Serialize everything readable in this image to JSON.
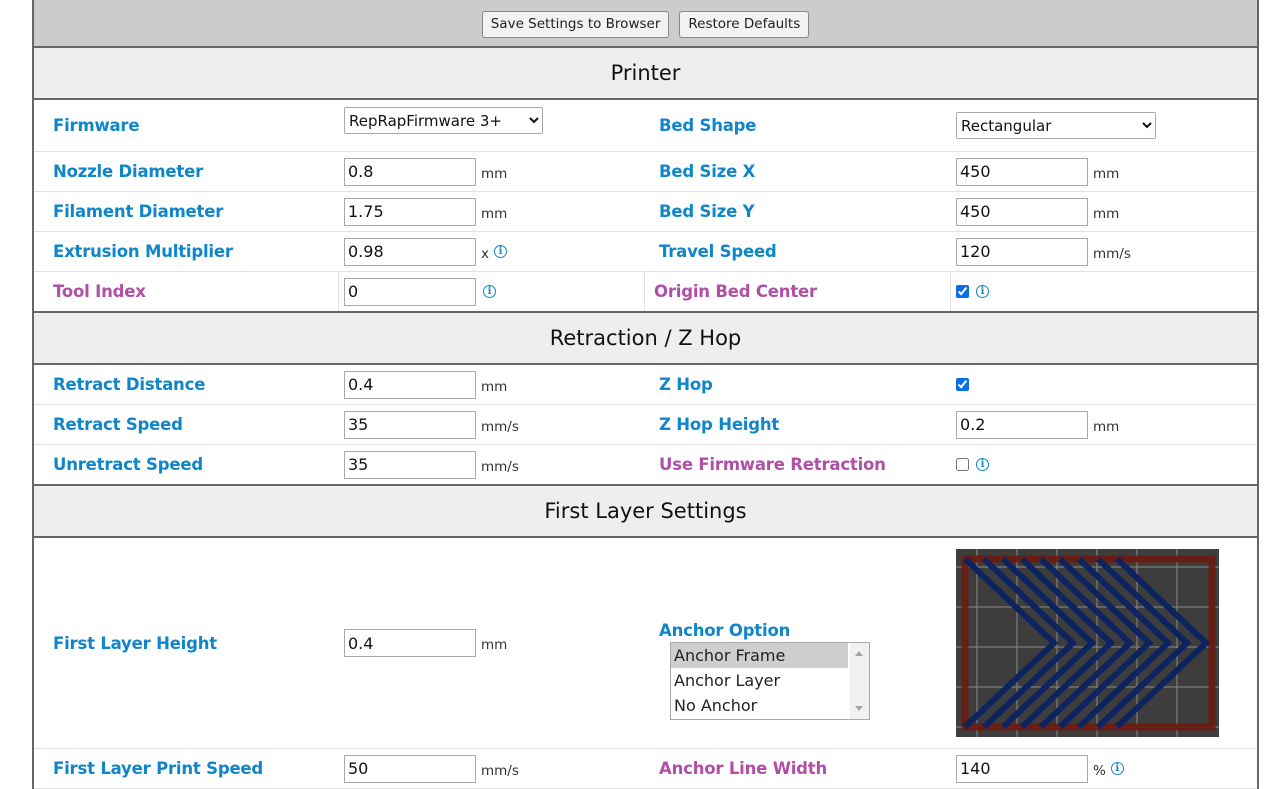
{
  "toolbar": {
    "save_label": "Save Settings to Browser",
    "restore_label": "Restore Defaults"
  },
  "sections": {
    "printer": {
      "title": "Printer",
      "firmware": {
        "label": "Firmware",
        "value": "RepRapFirmware 3+"
      },
      "bed_shape": {
        "label": "Bed Shape",
        "value": "Rectangular"
      },
      "nozzle_diameter": {
        "label": "Nozzle Diameter",
        "value": "0.8",
        "unit": "mm"
      },
      "bed_size_x": {
        "label": "Bed Size X",
        "value": "450",
        "unit": "mm"
      },
      "filament_diameter": {
        "label": "Filament Diameter",
        "value": "1.75",
        "unit": "mm"
      },
      "bed_size_y": {
        "label": "Bed Size Y",
        "value": "450",
        "unit": "mm"
      },
      "extrusion_multiplier": {
        "label": "Extrusion Multiplier",
        "value": "0.98",
        "unit": "x"
      },
      "travel_speed": {
        "label": "Travel Speed",
        "value": "120",
        "unit": "mm/s"
      },
      "tool_index": {
        "label": "Tool Index",
        "value": "0"
      },
      "origin_bed_center": {
        "label": "Origin Bed Center",
        "checked": true
      }
    },
    "retraction": {
      "title": "Retraction / Z Hop",
      "retract_distance": {
        "label": "Retract Distance",
        "value": "0.4",
        "unit": "mm"
      },
      "z_hop": {
        "label": "Z Hop",
        "checked": true
      },
      "retract_speed": {
        "label": "Retract Speed",
        "value": "35",
        "unit": "mm/s"
      },
      "z_hop_height": {
        "label": "Z Hop Height",
        "value": "0.2",
        "unit": "mm"
      },
      "unretract_speed": {
        "label": "Unretract Speed",
        "value": "35",
        "unit": "mm/s"
      },
      "use_firmware_retraction": {
        "label": "Use Firmware Retraction",
        "checked": false
      }
    },
    "first_layer": {
      "title": "First Layer Settings",
      "first_layer_height": {
        "label": "First Layer Height",
        "value": "0.4",
        "unit": "mm"
      },
      "anchor_option": {
        "label": "Anchor Option",
        "options": [
          "Anchor Frame",
          "Anchor Layer",
          "No Anchor"
        ],
        "selected": "Anchor Frame"
      },
      "preview": {
        "background": "#3d3d3d",
        "grid_color": "#8a8a8a",
        "frame_color": "#6b1a10",
        "chevron_color": "#0d2460",
        "chevron_count": 9
      },
      "first_layer_print_speed": {
        "label": "First Layer Print Speed",
        "value": "50",
        "unit": "mm/s"
      },
      "anchor_line_width": {
        "label": "Anchor Line Width",
        "value": "140",
        "unit": "%"
      }
    }
  },
  "colors": {
    "label_basic": "#0e86c9",
    "label_advanced": "#b04fa8",
    "toolbar_bg": "#cccccc",
    "section_bg": "#eeeeee"
  },
  "icons": {
    "info": "info-circle-icon"
  }
}
